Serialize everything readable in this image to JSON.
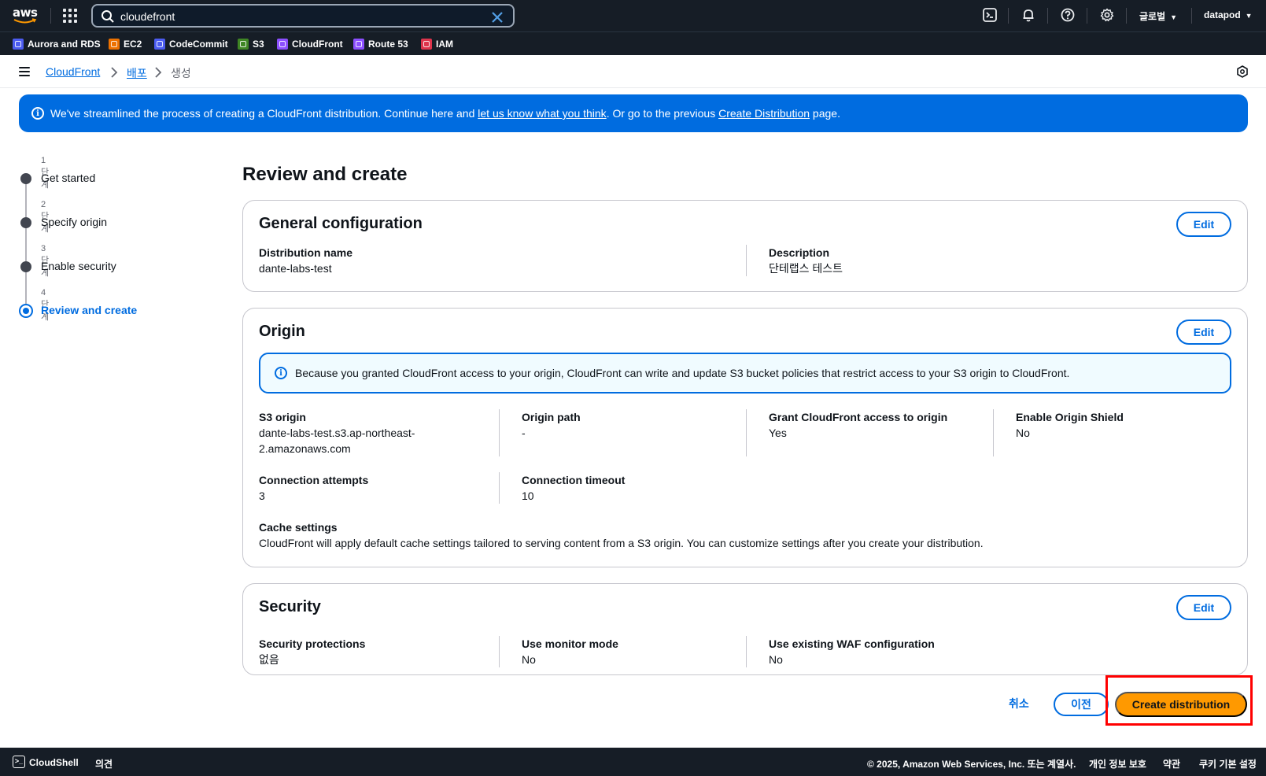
{
  "topnav": {
    "search_value": "cloudefront",
    "region_label": "글로벌",
    "account_label": "datapod"
  },
  "favorites": [
    {
      "label": "Aurora and RDS",
      "color": "#4c5cf0"
    },
    {
      "label": "EC2",
      "color": "#ed7100"
    },
    {
      "label": "CodeCommit",
      "color": "#4c5cf0"
    },
    {
      "label": "S3",
      "color": "#3f8624"
    },
    {
      "label": "CloudFront",
      "color": "#8c4fff"
    },
    {
      "label": "Route 53",
      "color": "#8c4fff"
    },
    {
      "label": "IAM",
      "color": "#dd344c"
    }
  ],
  "breadcrumb": {
    "service": "CloudFront",
    "section": "배포",
    "current": "생성"
  },
  "banner": {
    "text_before": "We've streamlined the process of creating a CloudFront distribution. Continue here and ",
    "link1": "let us know what you think",
    "text_middle": ". Or go to the previous ",
    "link2": "Create Distribution",
    "text_after": " page."
  },
  "steps": [
    {
      "num": "1단계",
      "label": "Get started"
    },
    {
      "num": "2단계",
      "label": "Specify origin"
    },
    {
      "num": "3단계",
      "label": "Enable security"
    },
    {
      "num": "4단계",
      "label": "Review and create"
    }
  ],
  "page_title": "Review and create",
  "edit_label": "Edit",
  "general": {
    "title": "General configuration",
    "name_key": "Distribution name",
    "name_value": "dante-labs-test",
    "desc_key": "Description",
    "desc_value": "단테랩스 테스트"
  },
  "origin": {
    "title": "Origin",
    "alert": "Because you granted CloudFront access to your origin, CloudFront can write and update S3 bucket policies that restrict access to your S3 origin to CloudFront.",
    "s3_origin_key": "S3 origin",
    "s3_origin_value_line1": "dante-labs-test.s3.ap-northeast-",
    "s3_origin_value_line2": "2.amazonaws.com",
    "origin_path_key": "Origin path",
    "origin_path_value": "-",
    "grant_key": "Grant CloudFront access to origin",
    "grant_value": "Yes",
    "shield_key": "Enable Origin Shield",
    "shield_value": "No",
    "attempts_key": "Connection attempts",
    "attempts_value": "3",
    "timeout_key": "Connection timeout",
    "timeout_value": "10",
    "cache_key": "Cache settings",
    "cache_value": "CloudFront will apply default cache settings tailored to serving content from a S3 origin. You can customize settings after you create your distribution."
  },
  "security": {
    "title": "Security",
    "protections_key": "Security protections",
    "protections_value": "없음",
    "monitor_key": "Use monitor mode",
    "monitor_value": "No",
    "waf_key": "Use existing WAF configuration",
    "waf_value": "No"
  },
  "actions": {
    "cancel": "취소",
    "previous": "이전",
    "create": "Create distribution"
  },
  "bottombar": {
    "cloudshell": "CloudShell",
    "feedback": "의견",
    "copyright": "© 2025, Amazon Web Services, Inc. 또는 계열사.",
    "privacy": "개인 정보 보호",
    "terms": "약관",
    "cookies": "쿠키 기본 설정"
  }
}
